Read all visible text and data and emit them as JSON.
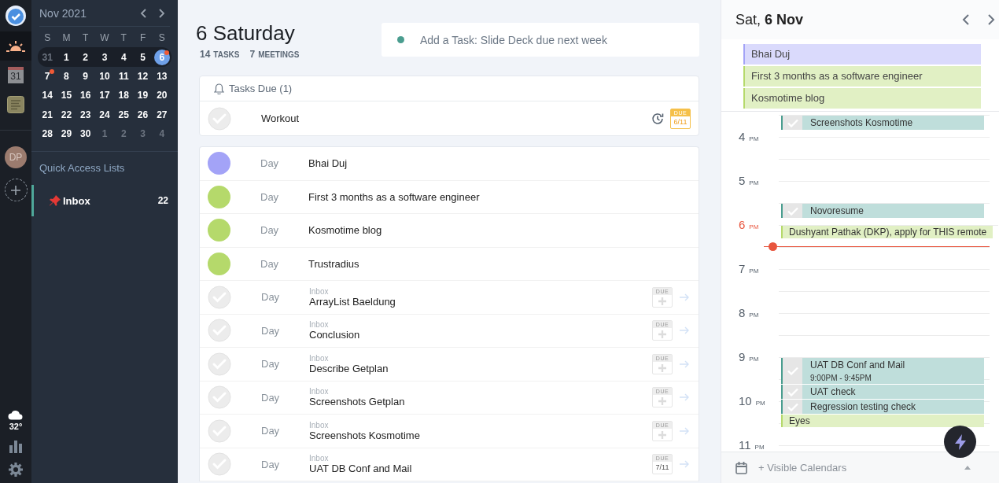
{
  "rail": {
    "top": [
      {
        "kind": "logo",
        "selected": false
      },
      {
        "kind": "today",
        "selected": true
      },
      {
        "kind": "calendar",
        "label": "31",
        "selected": false
      },
      {
        "kind": "notes",
        "selected": false
      }
    ],
    "avatar": {
      "initials": "DP"
    },
    "weather": {
      "temperature": "32°"
    },
    "bottom": [
      {
        "kind": "stats"
      },
      {
        "kind": "settings"
      }
    ]
  },
  "sidebar": {
    "mini_calendar": {
      "title": "Nov 2021",
      "weekdays": [
        "S",
        "M",
        "T",
        "W",
        "T",
        "F",
        "S"
      ],
      "weeks": [
        {
          "current": true,
          "days": [
            {
              "label": "31",
              "other_month": true,
              "selected": false,
              "dot": false
            },
            {
              "label": "1",
              "other_month": false,
              "selected": false,
              "dot": false
            },
            {
              "label": "2",
              "other_month": false,
              "selected": false,
              "dot": false
            },
            {
              "label": "3",
              "other_month": false,
              "selected": false,
              "dot": false
            },
            {
              "label": "4",
              "other_month": false,
              "selected": false,
              "dot": false
            },
            {
              "label": "5",
              "other_month": false,
              "selected": false,
              "dot": false
            },
            {
              "label": "6",
              "other_month": false,
              "selected": true,
              "dot": true
            }
          ]
        },
        {
          "current": false,
          "days": [
            {
              "label": "7",
              "other_month": false,
              "selected": false,
              "dot": true
            },
            {
              "label": "8",
              "other_month": false,
              "selected": false,
              "dot": false
            },
            {
              "label": "9",
              "other_month": false,
              "selected": false,
              "dot": false
            },
            {
              "label": "10",
              "other_month": false,
              "selected": false,
              "dot": false
            },
            {
              "label": "11",
              "other_month": false,
              "selected": false,
              "dot": false
            },
            {
              "label": "12",
              "other_month": false,
              "selected": false,
              "dot": false
            },
            {
              "label": "13",
              "other_month": false,
              "selected": false,
              "dot": false
            }
          ]
        },
        {
          "current": false,
          "days": [
            {
              "label": "14",
              "other_month": false,
              "selected": false,
              "dot": false
            },
            {
              "label": "15",
              "other_month": false,
              "selected": false,
              "dot": false
            },
            {
              "label": "16",
              "other_month": false,
              "selected": false,
              "dot": false
            },
            {
              "label": "17",
              "other_month": false,
              "selected": false,
              "dot": false
            },
            {
              "label": "18",
              "other_month": false,
              "selected": false,
              "dot": false
            },
            {
              "label": "19",
              "other_month": false,
              "selected": false,
              "dot": false
            },
            {
              "label": "20",
              "other_month": false,
              "selected": false,
              "dot": false
            }
          ]
        },
        {
          "current": false,
          "days": [
            {
              "label": "21",
              "other_month": false,
              "selected": false,
              "dot": false
            },
            {
              "label": "22",
              "other_month": false,
              "selected": false,
              "dot": false
            },
            {
              "label": "23",
              "other_month": false,
              "selected": false,
              "dot": false
            },
            {
              "label": "24",
              "other_month": false,
              "selected": false,
              "dot": false
            },
            {
              "label": "25",
              "other_month": false,
              "selected": false,
              "dot": false
            },
            {
              "label": "26",
              "other_month": false,
              "selected": false,
              "dot": false
            },
            {
              "label": "27",
              "other_month": false,
              "selected": false,
              "dot": false
            }
          ]
        },
        {
          "current": false,
          "days": [
            {
              "label": "28",
              "other_month": false,
              "selected": false,
              "dot": false
            },
            {
              "label": "29",
              "other_month": false,
              "selected": false,
              "dot": false
            },
            {
              "label": "30",
              "other_month": false,
              "selected": false,
              "dot": false
            },
            {
              "label": "1",
              "other_month": true,
              "selected": false,
              "dot": false
            },
            {
              "label": "2",
              "other_month": true,
              "selected": false,
              "dot": false
            },
            {
              "label": "3",
              "other_month": true,
              "selected": false,
              "dot": false
            },
            {
              "label": "4",
              "other_month": true,
              "selected": false,
              "dot": false
            }
          ]
        }
      ]
    },
    "quick_access": {
      "title": "Quick Access Lists",
      "lists": [
        {
          "name": "Inbox",
          "count": "22",
          "selected": true
        }
      ]
    }
  },
  "main": {
    "date_title": "6 Saturday",
    "stats": [
      {
        "count": "14",
        "label": "TASKS"
      },
      {
        "count": "7",
        "label": "MEETINGS"
      }
    ],
    "add_task": {
      "placeholder": "Add a Task: Slide Deck due next week"
    },
    "tasks_due": {
      "title": "Tasks Due (1)",
      "items": [
        {
          "checked": false,
          "title": "Workout",
          "repeat": true,
          "due_label": "DUE",
          "due_date": "6/11",
          "due_today": true
        }
      ]
    },
    "agenda": [
      {
        "kind": "event",
        "color": "#a3a3f7",
        "type_label": "Day",
        "title": "Bhai Duj"
      },
      {
        "kind": "event",
        "color": "#b5d96b",
        "type_label": "Day",
        "title": "First 3 months as a software engineer"
      },
      {
        "kind": "event",
        "color": "#b5d96b",
        "type_label": "Day",
        "title": "Kosmotime blog"
      },
      {
        "kind": "event",
        "color": "#b5d96b",
        "type_label": "Day",
        "title": "Trustradius"
      },
      {
        "kind": "task",
        "checked": false,
        "type_label": "Day",
        "list": "Inbox",
        "title": "ArrayList Baeldung",
        "due_label": "DUE"
      },
      {
        "kind": "task",
        "checked": false,
        "type_label": "Day",
        "list": "Inbox",
        "title": "Conclusion",
        "due_label": "DUE"
      },
      {
        "kind": "task",
        "checked": false,
        "type_label": "Day",
        "list": "Inbox",
        "title": "Describe Getplan",
        "due_label": "DUE"
      },
      {
        "kind": "task",
        "checked": false,
        "type_label": "Day",
        "list": "Inbox",
        "title": "Screenshots Getplan",
        "due_label": "DUE"
      },
      {
        "kind": "task",
        "checked": false,
        "type_label": "Day",
        "list": "Inbox",
        "title": "Screenshots Kosmotime",
        "due_label": "DUE"
      },
      {
        "kind": "task",
        "checked": false,
        "type_label": "Day",
        "list": "Inbox",
        "title": "UAT DB Conf and Mail",
        "due_label": "DUE",
        "due_date": "7/11"
      }
    ]
  },
  "day_panel": {
    "title": "Sat, **6 Nov**",
    "all_day": [
      {
        "title": "Bhai Duj",
        "color": "#a3a3f7"
      },
      {
        "title": "First 3 months as a software engineer",
        "color": "#b5d96b"
      },
      {
        "title": "Kosmotime blog",
        "color": "#b5d96b"
      }
    ],
    "timeline": {
      "earlier_events": [
        {
          "kind": "task",
          "title": "Screenshots Kosmotime"
        }
      ],
      "hours": [
        {
          "hour": "4",
          "suffix": "PM",
          "current": false
        },
        {
          "hour": "5",
          "suffix": "PM",
          "current": false,
          "half_past_events": [
            {
              "kind": "task",
              "title": "Novoresume"
            }
          ]
        },
        {
          "hour": "6",
          "suffix": "PM",
          "current": true,
          "now_half_past": true,
          "events": [
            {
              "kind": "event",
              "color": "#b5d96b",
              "title": "Dushyant Pathak (DKP), apply for THIS remote"
            }
          ]
        },
        {
          "hour": "7",
          "suffix": "PM",
          "current": false
        },
        {
          "hour": "8",
          "suffix": "PM",
          "current": false
        },
        {
          "hour": "9",
          "suffix": "PM",
          "current": false,
          "events": [
            {
              "kind": "task",
              "title": "UAT DB Conf and Mail",
              "time": "9:00PM - 9:45PM"
            },
            {
              "kind": "task",
              "title": "UAT check"
            },
            {
              "kind": "task",
              "title": "Regression testing check"
            },
            {
              "kind": "event",
              "color": "#b5d96b",
              "title": "Eyes"
            }
          ]
        },
        {
          "hour": "10",
          "suffix": "PM",
          "current": false
        },
        {
          "hour": "11",
          "suffix": "PM",
          "current": false
        }
      ]
    },
    "footer": {
      "label": "+ Visible Calendars"
    }
  }
}
